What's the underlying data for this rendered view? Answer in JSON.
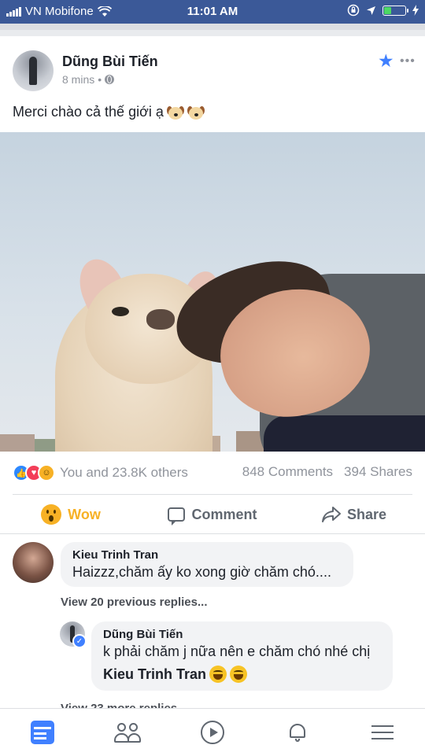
{
  "status_bar": {
    "carrier": "VN Mobifone",
    "time": "11:01 AM",
    "icons": [
      "signal-icon",
      "wifi-icon",
      "lock-rotation-icon",
      "location-icon",
      "battery-icon",
      "charging-icon"
    ],
    "battery_level": 0.4
  },
  "post": {
    "author": "Dũng Bùi Tiến",
    "time": "8 mins",
    "separator": "•",
    "text": "Merci chào cả thế giới ạ",
    "emojis": [
      "dog-face-emoji",
      "dog-face-emoji"
    ],
    "reactions": {
      "icons": [
        "like-icon",
        "love-icon",
        "haha-icon"
      ],
      "summary": "You and 23.8K others",
      "comments": "848 Comments",
      "shares": "394 Shares"
    },
    "actions": {
      "wow": "Wow",
      "comment": "Comment",
      "share": "Share"
    }
  },
  "comments": [
    {
      "name": "Kieu Trinh Tran",
      "text": "Haizzz,chăm ấy ko xong giờ chăm chó...."
    }
  ],
  "view_previous_replies": "View 20 previous replies...",
  "reply": {
    "name": "Dũng Bùi Tiến",
    "text": "k phải chăm j nữa nên e chăm chó nhé chị",
    "mention": "Kieu Trinh Tran",
    "emojis": [
      "laughing-tears-emoji",
      "laughing-tears-emoji"
    ]
  },
  "view_more_replies": "View 23 more replies",
  "tab_bar": {
    "tabs": [
      "news-feed-icon",
      "friends-icon",
      "video-icon",
      "notifications-icon",
      "menu-icon"
    ],
    "active_color": "#4080ff"
  },
  "colors": {
    "brand": "#3b5998",
    "wow": "#f7b125",
    "link_blue": "#4080ff"
  }
}
